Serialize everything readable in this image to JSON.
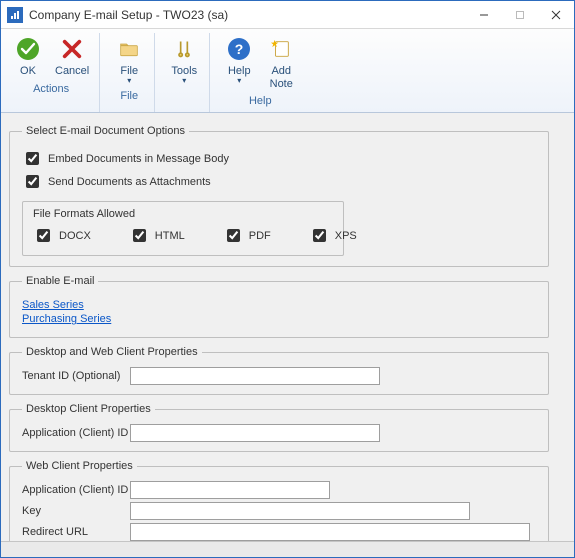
{
  "window": {
    "title": "Company E-mail Setup  -  TWO23 (sa)"
  },
  "ribbon": {
    "ok": "OK",
    "cancel": "Cancel",
    "file": "File",
    "tools": "Tools",
    "help": "Help",
    "addnote_l1": "Add",
    "addnote_l2": "Note",
    "group_actions": "Actions",
    "group_file": "File",
    "group_help": "Help"
  },
  "doc_options": {
    "legend": "Select E-mail Document Options",
    "embed": "Embed Documents in Message Body",
    "attach": "Send Documents as Attachments",
    "fmt_title": "File Formats Allowed",
    "fmt_docx": "DOCX",
    "fmt_html": "HTML",
    "fmt_pdf": "PDF",
    "fmt_xps": "XPS"
  },
  "enable_email": {
    "legend": "Enable E-mail",
    "sales": "Sales Series",
    "purchasing": "Purchasing Series"
  },
  "desktop_web": {
    "legend": "Desktop and Web Client Properties",
    "tenant_label": "Tenant ID (Optional)",
    "tenant_value": ""
  },
  "desktop": {
    "legend": "Desktop Client Properties",
    "appid_label": "Application (Client) ID",
    "appid_value": ""
  },
  "web": {
    "legend": "Web Client Properties",
    "appid_label": "Application (Client) ID",
    "appid_value": "",
    "key_label": "Key",
    "key_value": "",
    "redirect_label": "Redirect URL",
    "redirect_value": ""
  }
}
